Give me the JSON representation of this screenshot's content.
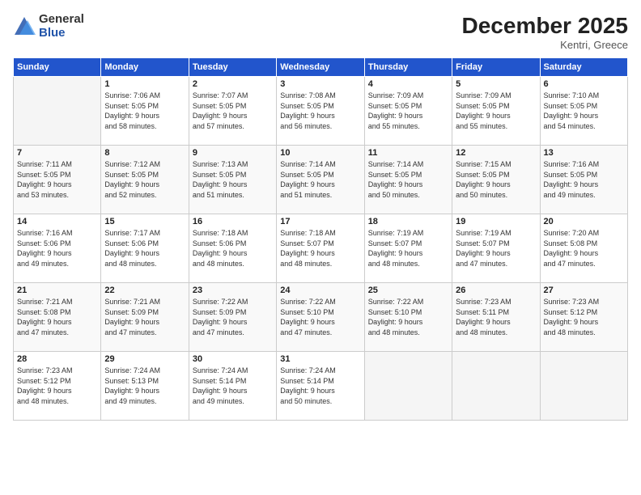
{
  "logo": {
    "general": "General",
    "blue": "Blue"
  },
  "header": {
    "month": "December 2025",
    "location": "Kentri, Greece"
  },
  "weekdays": [
    "Sunday",
    "Monday",
    "Tuesday",
    "Wednesday",
    "Thursday",
    "Friday",
    "Saturday"
  ],
  "weeks": [
    [
      {
        "day": "",
        "info": ""
      },
      {
        "day": "1",
        "info": "Sunrise: 7:06 AM\nSunset: 5:05 PM\nDaylight: 9 hours\nand 58 minutes."
      },
      {
        "day": "2",
        "info": "Sunrise: 7:07 AM\nSunset: 5:05 PM\nDaylight: 9 hours\nand 57 minutes."
      },
      {
        "day": "3",
        "info": "Sunrise: 7:08 AM\nSunset: 5:05 PM\nDaylight: 9 hours\nand 56 minutes."
      },
      {
        "day": "4",
        "info": "Sunrise: 7:09 AM\nSunset: 5:05 PM\nDaylight: 9 hours\nand 55 minutes."
      },
      {
        "day": "5",
        "info": "Sunrise: 7:09 AM\nSunset: 5:05 PM\nDaylight: 9 hours\nand 55 minutes."
      },
      {
        "day": "6",
        "info": "Sunrise: 7:10 AM\nSunset: 5:05 PM\nDaylight: 9 hours\nand 54 minutes."
      }
    ],
    [
      {
        "day": "7",
        "info": "Sunrise: 7:11 AM\nSunset: 5:05 PM\nDaylight: 9 hours\nand 53 minutes."
      },
      {
        "day": "8",
        "info": "Sunrise: 7:12 AM\nSunset: 5:05 PM\nDaylight: 9 hours\nand 52 minutes."
      },
      {
        "day": "9",
        "info": "Sunrise: 7:13 AM\nSunset: 5:05 PM\nDaylight: 9 hours\nand 51 minutes."
      },
      {
        "day": "10",
        "info": "Sunrise: 7:14 AM\nSunset: 5:05 PM\nDaylight: 9 hours\nand 51 minutes."
      },
      {
        "day": "11",
        "info": "Sunrise: 7:14 AM\nSunset: 5:05 PM\nDaylight: 9 hours\nand 50 minutes."
      },
      {
        "day": "12",
        "info": "Sunrise: 7:15 AM\nSunset: 5:05 PM\nDaylight: 9 hours\nand 50 minutes."
      },
      {
        "day": "13",
        "info": "Sunrise: 7:16 AM\nSunset: 5:05 PM\nDaylight: 9 hours\nand 49 minutes."
      }
    ],
    [
      {
        "day": "14",
        "info": "Sunrise: 7:16 AM\nSunset: 5:06 PM\nDaylight: 9 hours\nand 49 minutes."
      },
      {
        "day": "15",
        "info": "Sunrise: 7:17 AM\nSunset: 5:06 PM\nDaylight: 9 hours\nand 48 minutes."
      },
      {
        "day": "16",
        "info": "Sunrise: 7:18 AM\nSunset: 5:06 PM\nDaylight: 9 hours\nand 48 minutes."
      },
      {
        "day": "17",
        "info": "Sunrise: 7:18 AM\nSunset: 5:07 PM\nDaylight: 9 hours\nand 48 minutes."
      },
      {
        "day": "18",
        "info": "Sunrise: 7:19 AM\nSunset: 5:07 PM\nDaylight: 9 hours\nand 48 minutes."
      },
      {
        "day": "19",
        "info": "Sunrise: 7:19 AM\nSunset: 5:07 PM\nDaylight: 9 hours\nand 47 minutes."
      },
      {
        "day": "20",
        "info": "Sunrise: 7:20 AM\nSunset: 5:08 PM\nDaylight: 9 hours\nand 47 minutes."
      }
    ],
    [
      {
        "day": "21",
        "info": "Sunrise: 7:21 AM\nSunset: 5:08 PM\nDaylight: 9 hours\nand 47 minutes."
      },
      {
        "day": "22",
        "info": "Sunrise: 7:21 AM\nSunset: 5:09 PM\nDaylight: 9 hours\nand 47 minutes."
      },
      {
        "day": "23",
        "info": "Sunrise: 7:22 AM\nSunset: 5:09 PM\nDaylight: 9 hours\nand 47 minutes."
      },
      {
        "day": "24",
        "info": "Sunrise: 7:22 AM\nSunset: 5:10 PM\nDaylight: 9 hours\nand 47 minutes."
      },
      {
        "day": "25",
        "info": "Sunrise: 7:22 AM\nSunset: 5:10 PM\nDaylight: 9 hours\nand 48 minutes."
      },
      {
        "day": "26",
        "info": "Sunrise: 7:23 AM\nSunset: 5:11 PM\nDaylight: 9 hours\nand 48 minutes."
      },
      {
        "day": "27",
        "info": "Sunrise: 7:23 AM\nSunset: 5:12 PM\nDaylight: 9 hours\nand 48 minutes."
      }
    ],
    [
      {
        "day": "28",
        "info": "Sunrise: 7:23 AM\nSunset: 5:12 PM\nDaylight: 9 hours\nand 48 minutes."
      },
      {
        "day": "29",
        "info": "Sunrise: 7:24 AM\nSunset: 5:13 PM\nDaylight: 9 hours\nand 49 minutes."
      },
      {
        "day": "30",
        "info": "Sunrise: 7:24 AM\nSunset: 5:14 PM\nDaylight: 9 hours\nand 49 minutes."
      },
      {
        "day": "31",
        "info": "Sunrise: 7:24 AM\nSunset: 5:14 PM\nDaylight: 9 hours\nand 50 minutes."
      },
      {
        "day": "",
        "info": ""
      },
      {
        "day": "",
        "info": ""
      },
      {
        "day": "",
        "info": ""
      }
    ]
  ]
}
